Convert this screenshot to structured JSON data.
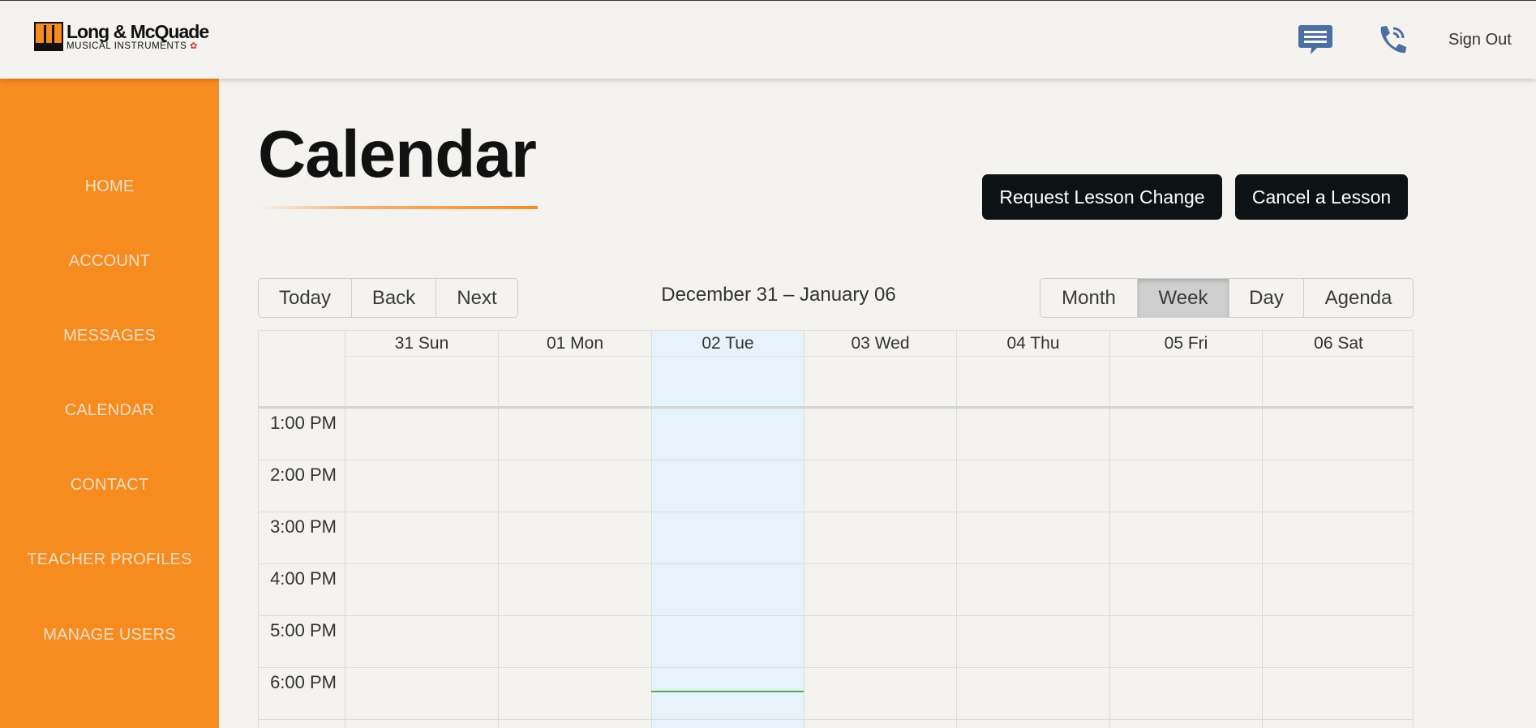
{
  "header": {
    "logo_name": "Long & McQuade",
    "logo_sub": "MUSICAL INSTRUMENTS",
    "messages_icon": "chat-bubble-icon",
    "phone_icon": "phone-icon",
    "sign_out": "Sign Out"
  },
  "sidebar": {
    "items": [
      {
        "label": "HOME"
      },
      {
        "label": "ACCOUNT"
      },
      {
        "label": "MESSAGES"
      },
      {
        "label": "CALENDAR"
      },
      {
        "label": "CONTACT"
      },
      {
        "label": "TEACHER PROFILES"
      },
      {
        "label": "MANAGE USERS"
      }
    ]
  },
  "main": {
    "title": "Calendar",
    "request_change": "Request Lesson Change",
    "cancel_lesson": "Cancel a Lesson"
  },
  "toolbar": {
    "today": "Today",
    "back": "Back",
    "next": "Next",
    "range": "December 31 – January 06",
    "views": [
      {
        "label": "Month",
        "active": false
      },
      {
        "label": "Week",
        "active": true
      },
      {
        "label": "Day",
        "active": false
      },
      {
        "label": "Agenda",
        "active": false
      }
    ]
  },
  "calendar": {
    "days": [
      "31 Sun",
      "01 Mon",
      "02 Tue",
      "03 Wed",
      "04 Thu",
      "05 Fri",
      "06 Sat"
    ],
    "today_index": 2,
    "times": [
      "1:00 PM",
      "2:00 PM",
      "3:00 PM",
      "4:00 PM",
      "5:00 PM",
      "6:00 PM"
    ]
  },
  "colors": {
    "sidebar": "#f68b1f",
    "today_column": "#e6f3fb",
    "now_indicator": "#4caf50",
    "icon": "#4a6fa5",
    "dark_button": "#0d1314"
  }
}
